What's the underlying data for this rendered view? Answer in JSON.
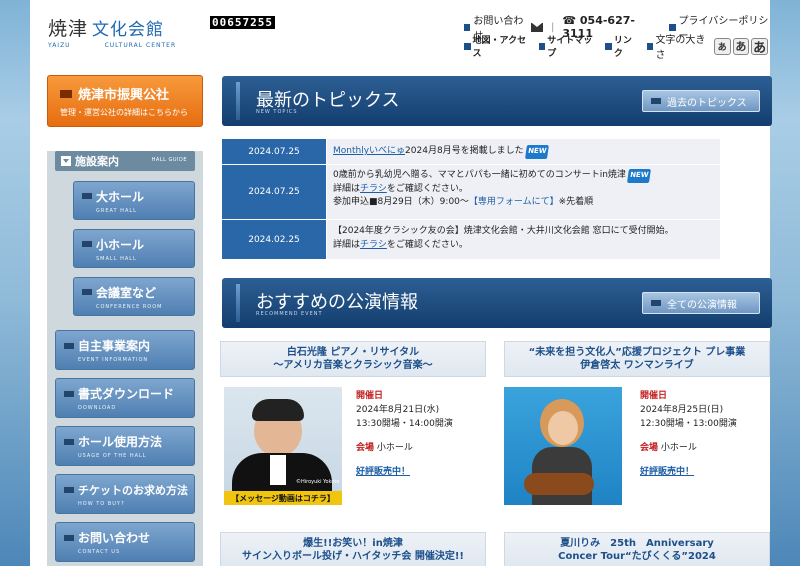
{
  "header": {
    "logo_main": "焼津",
    "logo_blue": "文化会館",
    "logo_sub_left": "YAIZU",
    "logo_sub_right": "CULTURAL CENTER",
    "counter": "00657255",
    "contact": "お問い合わせ",
    "phone": "☎ 054-627-3111",
    "privacy": "プライバシーポリシー",
    "access": "地図・アクセス",
    "sitemap": "サイトマップ",
    "links": "リンク",
    "font_size_label": "文字の大きさ",
    "font_small": "あ",
    "font_medium": "あ",
    "font_large": "あ"
  },
  "sidebar": {
    "promo_title": "焼津市振興公社",
    "promo_sub": "管理・運営公社の詳細はこちらから",
    "guide_label": "施設案内",
    "guide_sub": "HALL GUIDE",
    "halls": [
      {
        "label": "大ホール",
        "en": "GREAT HALL"
      },
      {
        "label": "小ホール",
        "en": "SMALL HALL"
      },
      {
        "label": "会議室など",
        "en": "CONFERENCE ROOM"
      }
    ],
    "menu": [
      {
        "label": "自主事業案内",
        "en": "EVENT INFORMATION"
      },
      {
        "label": "書式ダウンロード",
        "en": "DOWNLOAD"
      },
      {
        "label": "ホール使用方法",
        "en": "USAGE OF THE HALL"
      },
      {
        "label": "チケットのお求め方法",
        "en": "HOW TO BUY?"
      },
      {
        "label": "お問い合わせ",
        "en": "CONTACT US"
      }
    ]
  },
  "topics": {
    "title": "最新のトピックス",
    "sub": "NEW TOPICS",
    "button": "過去のトピックス",
    "items": [
      {
        "date": "2024.07.25",
        "link": "Monthlyいべにゅ",
        "text": "2024月8月号を掲載しました",
        "badge": "NEW"
      },
      {
        "date": "2024.07.25",
        "line1": "0歳前から乳幼児へ贈る、ママとパパも一緒に初めてのコンサートin焼津",
        "badge": "NEW",
        "line2a": "詳細は",
        "line2link": "チラシ",
        "line2b": "をご確認ください。",
        "line3a": "参加申込■8月29日（木）9:00～",
        "line3link": "【専用フォームにて】",
        "line3b": "※先着順"
      },
      {
        "date": "2024.02.25",
        "line1": "【2024年度クラシック友の会】焼津文化会館・大井川文化会館 窓口にて受付開始。",
        "line2a": "詳細は",
        "line2link": "チラシ",
        "line2b": "をご確認ください。"
      }
    ]
  },
  "recommend": {
    "title": "おすすめの公演情報",
    "sub": "RECOMMEND EVENT",
    "button": "全ての公演情報",
    "events": [
      {
        "title1": "白石光隆 ピアノ・リサイタル",
        "title2": "～アメリカ音楽とクラシック音楽～",
        "date_label": "開催日",
        "date": "2024年8月21日(水)",
        "time": "13:30開場・14:00開演",
        "venue_label": "会場",
        "venue": "小ホール",
        "status": "好評販売中！",
        "caption": "【メッセージ動画はコチラ】",
        "credit": "©Hiroyuki Yokote"
      },
      {
        "title1": "“未来を担う文化人”応援プロジェクト プレ事業",
        "title2": "伊倉啓太 ワンマンライブ",
        "date_label": "開催日",
        "date": "2024年8月25日(日)",
        "time": "12:30開場・13:00開演",
        "venue_label": "会場",
        "venue": "小ホール",
        "status": "好評販売中！"
      },
      {
        "title1": "爆生!!お笑い！in焼津",
        "title2": "サイン入りボール投げ・ハイタッチ会 開催決定!!"
      },
      {
        "title1": "夏川りみ　25th　Anniversary",
        "title2": "Concer Tour“たびくくる”2024"
      }
    ]
  }
}
